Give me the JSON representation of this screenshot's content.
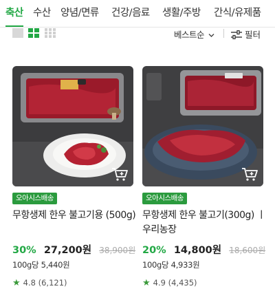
{
  "tabs": [
    {
      "label": "축산",
      "active": true
    },
    {
      "label": "수산",
      "active": false
    },
    {
      "label": "양념/면류",
      "active": false
    },
    {
      "label": "건강/음료",
      "active": false
    },
    {
      "label": "생활/주방",
      "active": false
    },
    {
      "label": "간식/유제품",
      "active": false
    }
  ],
  "toolbar": {
    "sort_label": "베스트순",
    "filter_label": "필터"
  },
  "colors": {
    "accent": "#22a845",
    "badge": "#2b9b3e"
  },
  "products": [
    {
      "badge": "오아시스배송",
      "title": "무항생제 한우 불고기용 (500g)",
      "discount": "30%",
      "price": "27,200원",
      "original_price": "38,900원",
      "unit_price": "100g당 5,440원",
      "rating": "4.8",
      "review_count": "(6,121)"
    },
    {
      "badge": "오아시스배송",
      "title": "무항생제 한우 불고기(300g) ㅣ우리농장",
      "discount": "20%",
      "price": "14,800원",
      "original_price": "18,600원",
      "unit_price": "100g당 4,933원",
      "rating": "4.9",
      "review_count": "(4,435)"
    }
  ]
}
